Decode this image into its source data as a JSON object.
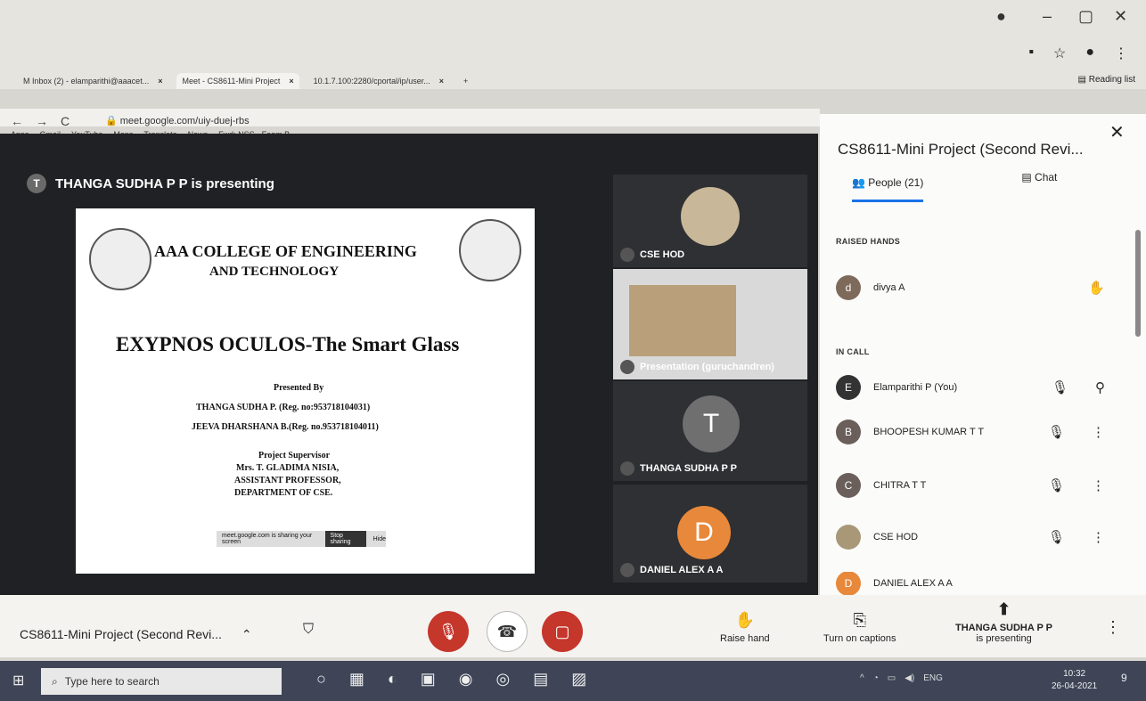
{
  "browser": {
    "tabs": [
      {
        "label": "M  Inbox (2) - elamparithi@aaacet..."
      },
      {
        "label": "Meet - CS8611-Mini Project"
      },
      {
        "label": "10.1.7.100:2280/cportal/ip/user..."
      }
    ],
    "url": "meet.google.com/uiy-duej-rbs",
    "bookmarks": [
      "Apps",
      "Gmail",
      "YouTube",
      "Maps",
      "Translate",
      "News",
      "Fwd: NSS - Foam B..."
    ],
    "reading_list": "Reading list"
  },
  "stage": {
    "presenter_initial": "T",
    "presenting_text": "THANGA SUDHA P P is presenting"
  },
  "slide": {
    "college_line1": "AAA COLLEGE OF ENGINEERING",
    "college_line2": "AND TECHNOLOGY",
    "title": "EXYPNOS OCULOS-The Smart Glass",
    "presented_by": "Presented By",
    "student1": "THANGA SUDHA P. (Reg. no:953718104031)",
    "student2": "JEEVA DHARSHANA B.(Reg. no.953718104011)",
    "supervisor_label": "Project Supervisor",
    "supervisor_name": "Mrs. T. GLADIMA NISIA,",
    "supervisor_title": "ASSISTANT PROFESSOR,",
    "supervisor_dept": "DEPARTMENT OF CSE.",
    "share_bar_text": "meet.google.com is sharing your screen",
    "stop_sharing": "Stop sharing",
    "hide": "Hide"
  },
  "tiles": [
    {
      "name": "CSE HOD"
    },
    {
      "name": "Presentation (guruchandren)"
    },
    {
      "name": "THANGA SUDHA P P",
      "initial": "T"
    },
    {
      "name": "DANIEL ALEX A A",
      "initial": "D"
    }
  ],
  "panel": {
    "title": "CS8611-Mini Project (Second Revi...",
    "people_tab": "People (21)",
    "chat_tab": "Chat",
    "raised_hands_label": "RAISED HANDS",
    "in_call_label": "IN CALL",
    "raised": [
      {
        "initial": "d",
        "name": "divya A"
      }
    ],
    "in_call": [
      {
        "initial": "E",
        "name": "Elamparithi P (You)"
      },
      {
        "initial": "B",
        "name": "BHOOPESH KUMAR T T"
      },
      {
        "initial": "C",
        "name": "CHITRA T T"
      },
      {
        "initial": "",
        "name": "CSE HOD"
      },
      {
        "initial": "D",
        "name": "DANIEL ALEX A A"
      }
    ]
  },
  "bottombar": {
    "meeting_name": "CS8611-Mini Project (Second Revi...",
    "raise_hand": "Raise hand",
    "captions": "Turn on captions",
    "presenting_line1": "THANGA SUDHA P P",
    "presenting_line2": "is presenting"
  },
  "taskbar": {
    "search_placeholder": "Type here to search",
    "lang": "ENG",
    "time": "10:32",
    "date": "26-04-2021",
    "notification_count": "9"
  },
  "colors": {
    "meet_dark": "#202124",
    "mic_off_red": "#c5362b",
    "accent_blue": "#1a73e8"
  }
}
